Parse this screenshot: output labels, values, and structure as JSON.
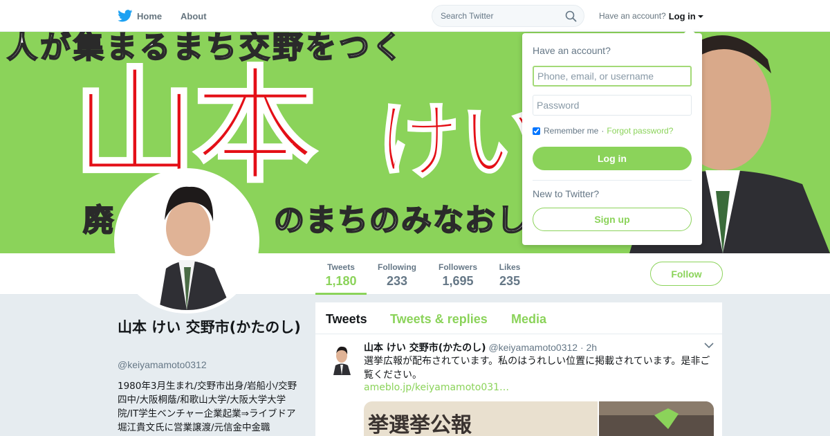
{
  "colors": {
    "accent": "#8bd35a",
    "banner_bg": "#8bd35a",
    "banner_red": "#e40f17",
    "page_bg": "#e6ecf0",
    "twitter_blue": "#1da1f2"
  },
  "nav": {
    "logo_icon": "twitter-bird-icon",
    "home_label": "Home",
    "about_label": "About",
    "search_placeholder": "Search Twitter",
    "search_icon": "search-icon",
    "account_prompt": "Have an account?",
    "login_label": "Log in"
  },
  "banner": {
    "top_line": "人が集まるまち交野をつく",
    "name_kanji": "山本",
    "name_kana": "けい",
    "slogan": "廃　　　　　のまちのみなおし"
  },
  "profile": {
    "display_name": "山本 けい 交野市(かたのし)",
    "handle": "@keiyamamoto0312",
    "bio": "1980年3月生まれ/交野市出身/岩船小/交野四中/大阪桐蔭/和歌山大学/大阪大学大学院/IT学生ベンチャー企業起業⇒ライブドア堀江貴文氏に営業譲渡/元信金中金職"
  },
  "stats": [
    {
      "label": "Tweets",
      "value": "1,180"
    },
    {
      "label": "Following",
      "value": "233"
    },
    {
      "label": "Followers",
      "value": "1,695"
    },
    {
      "label": "Likes",
      "value": "235"
    }
  ],
  "follow_label": "Follow",
  "timeline": {
    "tabs": [
      "Tweets",
      "Tweets & replies",
      "Media"
    ],
    "tweet": {
      "name": "山本 けい 交野市(かたのし)",
      "handle": "@keiyamamoto0312",
      "dot": "·",
      "time": "2h",
      "text": "選挙広報が配布されています。私のはうれしい位置に掲載されています。是非ご覧ください。",
      "link": "ameblo.jp/keiyamamoto031…",
      "media_text": "挙選挙公報"
    }
  },
  "login_dropdown": {
    "title": "Have an account?",
    "username_placeholder": "Phone, email, or username",
    "password_placeholder": "Password",
    "remember_label": "Remember me",
    "separator": "·",
    "forgot_label": "Forgot password?",
    "login_button": "Log in",
    "new_label": "New to Twitter?",
    "signup_button": "Sign up"
  }
}
